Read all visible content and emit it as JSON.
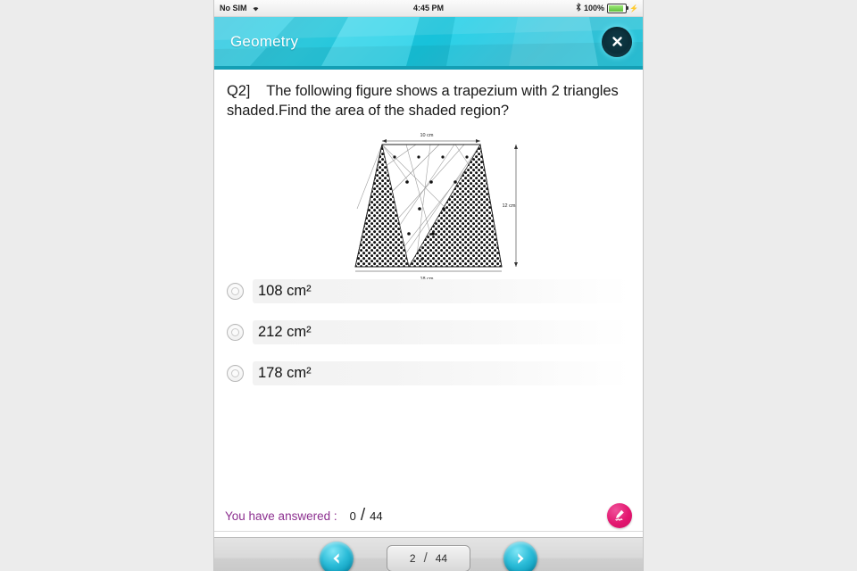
{
  "statusbar": {
    "carrier": "No SIM",
    "wifi_icon": "wifi-icon",
    "time": "4:45 PM",
    "bluetooth_icon": "bluetooth-icon",
    "battery_percent": "100%",
    "battery_icon": "battery-full-icon"
  },
  "header": {
    "title": "Geometry",
    "close_icon": "close-icon",
    "accent_color": "#19cfe8"
  },
  "question": {
    "number": "Q2]",
    "text": "The following figure shows a trapezium with 2 triangles shaded.Find the area of the shaded region?"
  },
  "figure": {
    "top_label": "10 cm",
    "right_label": "12 cm",
    "bottom_label": "18 cm",
    "description": "trapezium-with-two-shaded-triangles"
  },
  "options": [
    {
      "label": "108 cm²",
      "selected": false
    },
    {
      "label": "212 cm²",
      "selected": false
    },
    {
      "label": "178 cm²",
      "selected": false
    }
  ],
  "answered": {
    "label": "You have answered :",
    "count": "0",
    "separator": "/",
    "total": "44",
    "label_color": "#8c2f8f",
    "draw_icon": "pen-scribble-icon"
  },
  "bottomnav": {
    "prev_icon": "chevron-left-icon",
    "next_icon": "chevron-right-icon",
    "page_current": "2",
    "page_separator": "/",
    "page_total": "44"
  }
}
